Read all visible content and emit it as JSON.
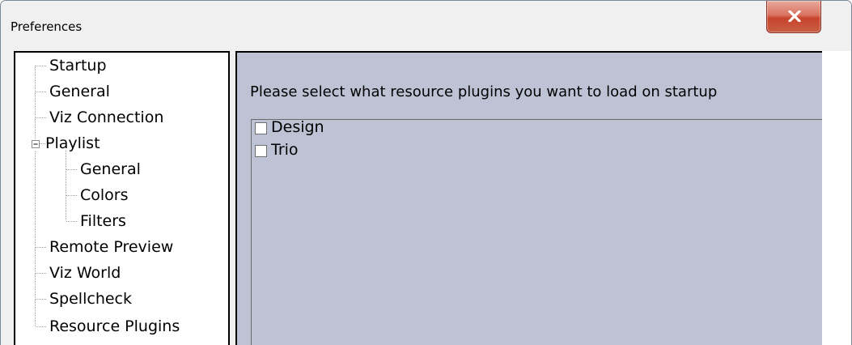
{
  "window": {
    "title": "Preferences",
    "close_icon": "close-x-icon"
  },
  "tree": {
    "items": [
      {
        "label": "Startup"
      },
      {
        "label": "General"
      },
      {
        "label": "Viz Connection"
      },
      {
        "label": "Playlist",
        "expanded": true
      },
      {
        "label": "General"
      },
      {
        "label": "Colors"
      },
      {
        "label": "Filters"
      },
      {
        "label": "Remote Preview"
      },
      {
        "label": "Viz World"
      },
      {
        "label": "Spellcheck"
      },
      {
        "label": "Resource Plugins"
      }
    ]
  },
  "content": {
    "instruction": "Please select what resource plugins you want to load on startup",
    "plugins": [
      {
        "label": "Design",
        "checked": false
      },
      {
        "label": "Trio",
        "checked": false
      }
    ]
  },
  "colors": {
    "panel_bg": "#bdc3d5",
    "window_bg": "#f0f0f0",
    "close_button": "#c8442c"
  }
}
